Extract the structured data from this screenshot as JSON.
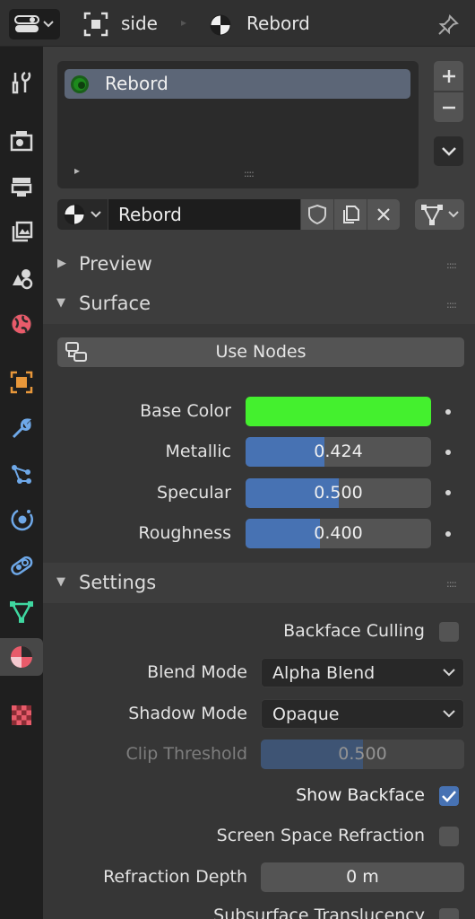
{
  "header": {
    "object_name": "side",
    "material_name": "Rebord"
  },
  "material_slots": {
    "items": [
      {
        "label": "Rebord",
        "color": "#1d8a1d"
      }
    ],
    "expand_marker": "▸",
    "drag_handle": "::::"
  },
  "material_selector": {
    "name": "Rebord"
  },
  "panels": {
    "preview": {
      "title": "Preview",
      "expanded": false
    },
    "surface": {
      "title": "Surface",
      "expanded": true
    },
    "settings": {
      "title": "Settings",
      "expanded": true
    }
  },
  "surface": {
    "use_nodes_label": "Use Nodes",
    "base_color_label": "Base Color",
    "base_color_value": "#44f02e",
    "metallic_label": "Metallic",
    "metallic_value": "0.424",
    "metallic_fraction": 0.424,
    "specular_label": "Specular",
    "specular_value": "0.500",
    "specular_fraction": 0.5,
    "roughness_label": "Roughness",
    "roughness_value": "0.400",
    "roughness_fraction": 0.4
  },
  "settings": {
    "backface_culling_label": "Backface Culling",
    "backface_culling_checked": false,
    "blend_mode_label": "Blend Mode",
    "blend_mode_value": "Alpha Blend",
    "shadow_mode_label": "Shadow Mode",
    "shadow_mode_value": "Opaque",
    "clip_threshold_label": "Clip Threshold",
    "clip_threshold_value": "0.500",
    "clip_threshold_fraction": 0.5,
    "show_backface_label": "Show Backface",
    "show_backface_checked": true,
    "ssr_label": "Screen Space Refraction",
    "ssr_checked": false,
    "refraction_depth_label": "Refraction Depth",
    "refraction_depth_value": "0 m",
    "subsurface_label": "Subsurface Translucency"
  },
  "colors": {
    "accent": "#4772b3",
    "tab_material_active": "#e85b6a"
  },
  "tabs": [
    "tool-icon",
    "render-icon",
    "output-icon",
    "view-layer-icon",
    "scene-icon",
    "world-icon",
    "object-icon",
    "modifier-icon",
    "particles-icon",
    "physics-icon",
    "constraints-icon",
    "object-data-icon",
    "material-icon",
    "texture-icon"
  ]
}
